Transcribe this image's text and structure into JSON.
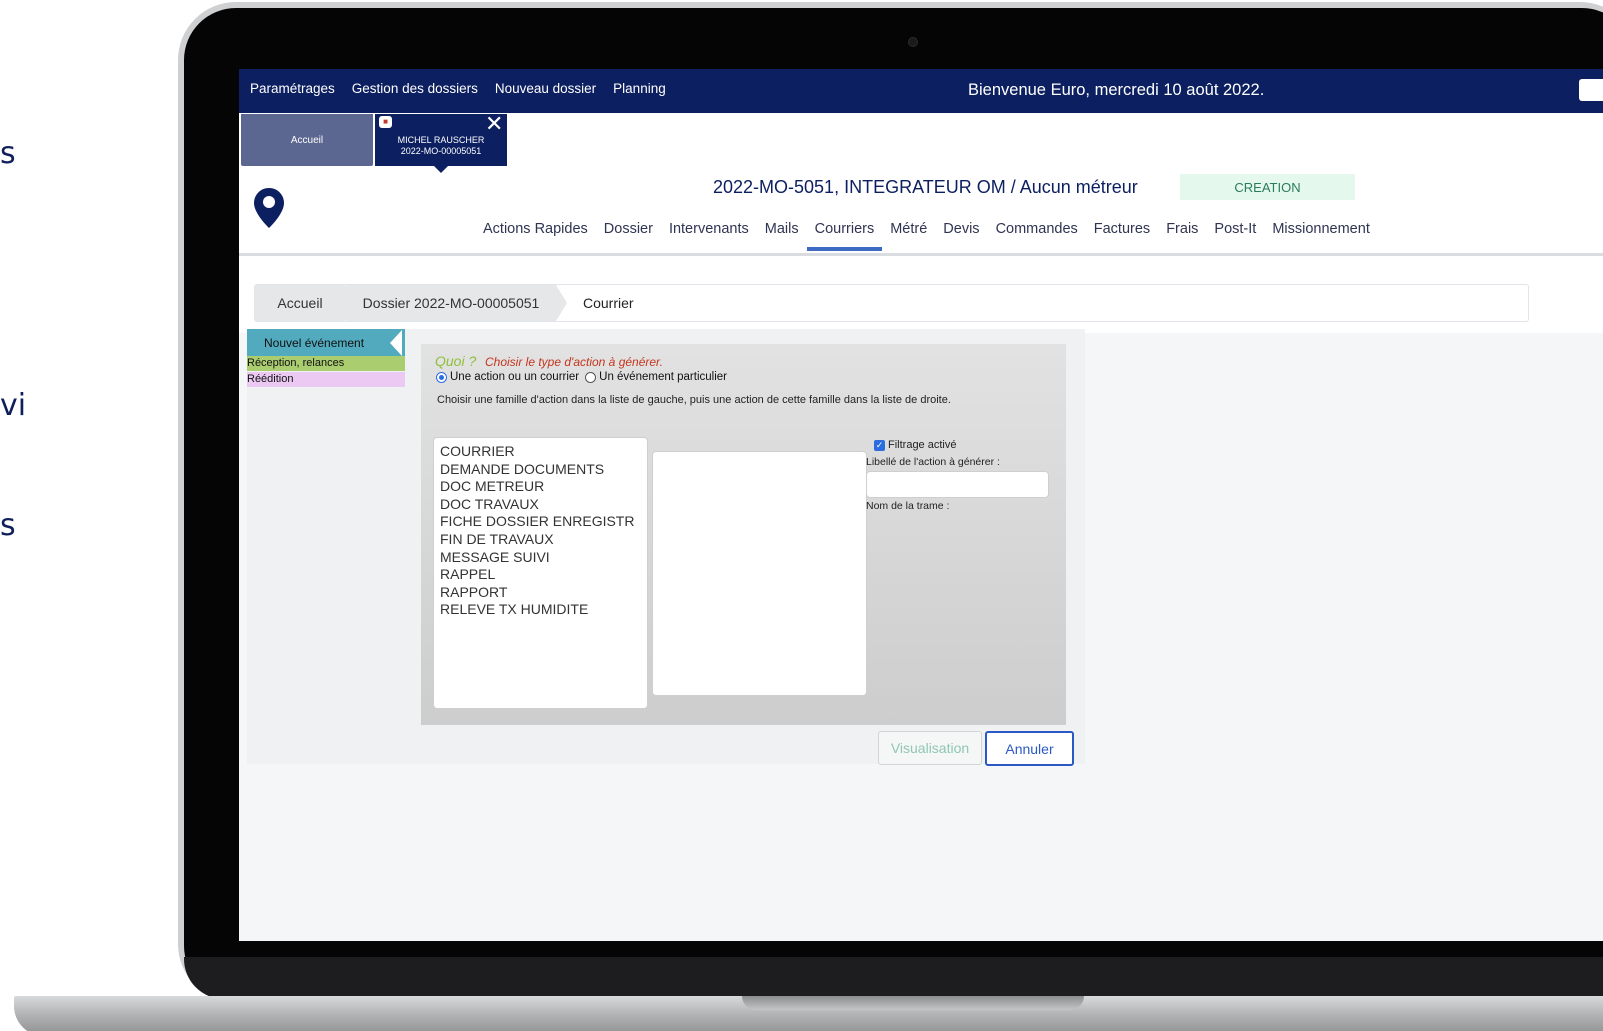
{
  "left_fragments": [
    "s",
    "vi",
    "s"
  ],
  "menu": [
    "Paramétrages",
    "Gestion des dossiers",
    "Nouveau dossier",
    "Planning"
  ],
  "welcome": "Bienvenue Euro, mercredi 10 août 2022.",
  "tabs": {
    "home": "Accueil",
    "file_line1": "MICHEL RAUSCHER",
    "file_line2": "2022-MO-00005051",
    "close": "✕"
  },
  "dossier": {
    "title": "2022-MO-5051, INTEGRATEUR OM / Aucun métreur",
    "status": "CREATION"
  },
  "nav_tabs": [
    "Actions Rapides",
    "Dossier",
    "Intervenants",
    "Mails",
    "Courriers",
    "Métré",
    "Devis",
    "Commandes",
    "Factures",
    "Frais",
    "Post-It",
    "Missionnement"
  ],
  "active_tab": "Courriers",
  "breadcrumb": [
    "Accueil",
    "Dossier 2022-MO-00005051",
    "Courrier"
  ],
  "sidebar": [
    "Nouvel événement",
    "Réception, relances",
    "Réédition"
  ],
  "form": {
    "quoi": "Quoi ?",
    "choisir": "Choisir le type d'action à générer.",
    "radio1": "Une action ou un courrier",
    "radio2": "Un événement particulier",
    "hint": "Choisir une famille d'action dans la liste de gauche, puis une action de cette famille dans la liste de droite.",
    "families": [
      "COURRIER",
      "DEMANDE DOCUMENTS",
      "DOC METREUR",
      "DOC TRAVAUX",
      "FICHE DOSSIER ENREGISTR",
      "FIN DE TRAVAUX",
      "MESSAGE SUIVI",
      "RAPPEL",
      "RAPPORT",
      "RELEVE TX HUMIDITE"
    ],
    "filtrage": "Filtrage activé",
    "libelle_label": "Libellé de l'action à générer :",
    "libelle_value": "",
    "trame_label": "Nom de la trame :"
  },
  "buttons": {
    "visualisation": "Visualisation",
    "annuler": "Annuler"
  },
  "colors": {
    "navy": "#0c1f60",
    "active_tab_underline": "#3d6bc4",
    "status_bg": "#e4f8ee",
    "sidebar_new": "#51aabd",
    "sidebar_rec": "#aacd70",
    "sidebar_red": "#ecc9f3"
  }
}
